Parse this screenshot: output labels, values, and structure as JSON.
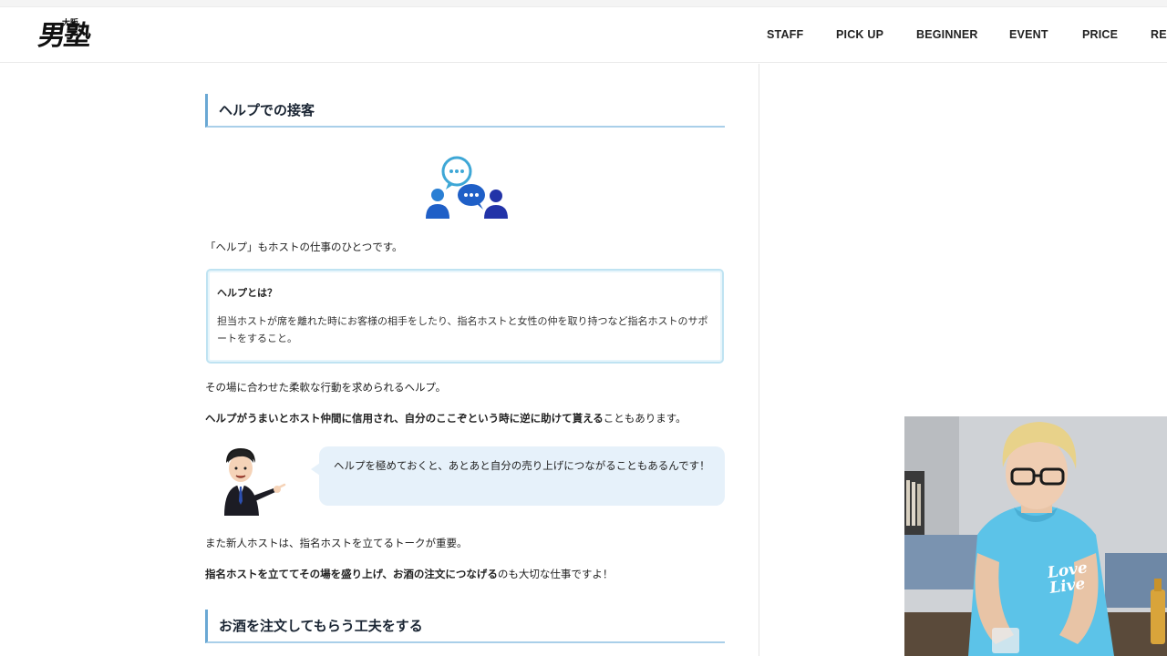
{
  "header": {
    "logo_small": "大阪",
    "logo_main": "男塾",
    "nav": [
      "STAFF",
      "PICK UP",
      "BEGINNER",
      "EVENT",
      "PRICE",
      "REC"
    ]
  },
  "section1": {
    "heading": "ヘルプでの接客",
    "intro": "「ヘルプ」もホストの仕事のひとつです。",
    "box_title": "ヘルプとは？",
    "box_body": "担当ホストが席を離れた時にお客様の相手をしたり、指名ホストと女性の仲を取り持つなど指名ホストのサポートをすること。",
    "para1": "その場に合わせた柔軟な行動を求められるヘルプ。",
    "para2_bold": "ヘルプがうまいとホスト仲間に信用され、自分のここぞという時に逆に助けて貰える",
    "para2_rest": "こともあります。",
    "speech": "ヘルプを極めておくと、あとあと自分の売り上げにつながることもあるんです！",
    "para3": "また新人ホストは、指名ホストを立てるトークが重要。",
    "para4_bold": "指名ホストを立ててその場を盛り上げ、お酒の注文につなげる",
    "para4_rest": "のも大切な仕事ですよ！"
  },
  "section2": {
    "heading": "お酒を注文してもらう工夫をする"
  },
  "webcam": {
    "shirt_text": "Love Live"
  },
  "colors": {
    "accent": "#6aa8d4",
    "bubble": "#e6f1fa",
    "icon_blue": "#1f5fc7",
    "icon_light": "#3ea7d6"
  }
}
